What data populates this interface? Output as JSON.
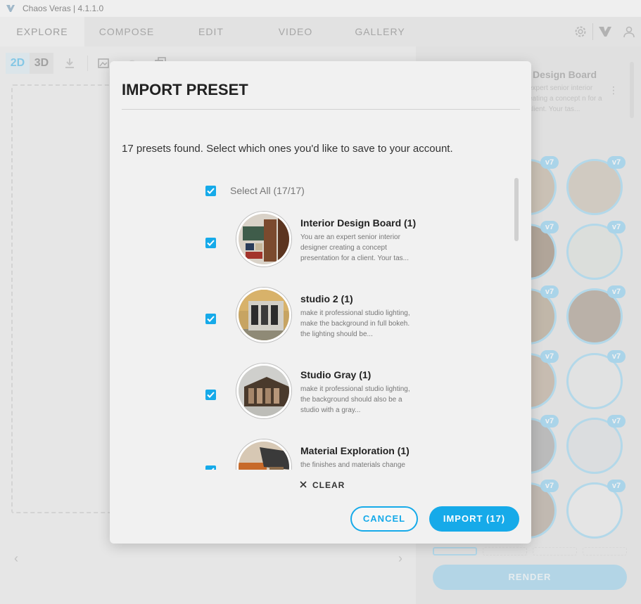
{
  "window": {
    "title": "Chaos Veras | 4.1.1.0"
  },
  "nav": {
    "tabs": [
      {
        "label": "EXPLORE",
        "active": true
      },
      {
        "label": "COMPOSE",
        "active": false
      },
      {
        "label": "EDIT",
        "active": false
      },
      {
        "label": "VIDEO",
        "active": false
      },
      {
        "label": "GALLERY",
        "active": false
      }
    ],
    "icons": [
      "gear-icon",
      "veras-logo-icon",
      "user-icon"
    ]
  },
  "toolbar": {
    "btn_2d": "2D",
    "btn_3d": "3D"
  },
  "right_panel": {
    "card_title": "Design Board",
    "card_desc": "expert senior interior eating a concept n for a client. Your tas...",
    "badge": "v7",
    "render_label": "RENDER"
  },
  "modal": {
    "title": "IMPORT PRESET",
    "description": "17 presets found. Select which ones you'd like to save to your account.",
    "select_all": "Select All (17/17)",
    "items": [
      {
        "name": "Interior Design Board (1)",
        "desc": "You are an expert senior interior designer creating a concept presentation for a client. Your tas..."
      },
      {
        "name": "studio 2 (1)",
        "desc": "make it professional studio lighting, make the background in full bokeh. the lighting should be..."
      },
      {
        "name": "Studio Gray (1)",
        "desc": "make it professional studio lighting, the background should also be a studio with a gray..."
      },
      {
        "name": "Material Exploration (1)",
        "desc": "the finishes and materials change"
      }
    ],
    "clear_label": "CLEAR",
    "cancel_label": "CANCEL",
    "import_label": "IMPORT (17)"
  },
  "colors": {
    "accent": "#16aae9",
    "badge": "#7fcaf0",
    "thumb_border": "#8fd1f1"
  }
}
